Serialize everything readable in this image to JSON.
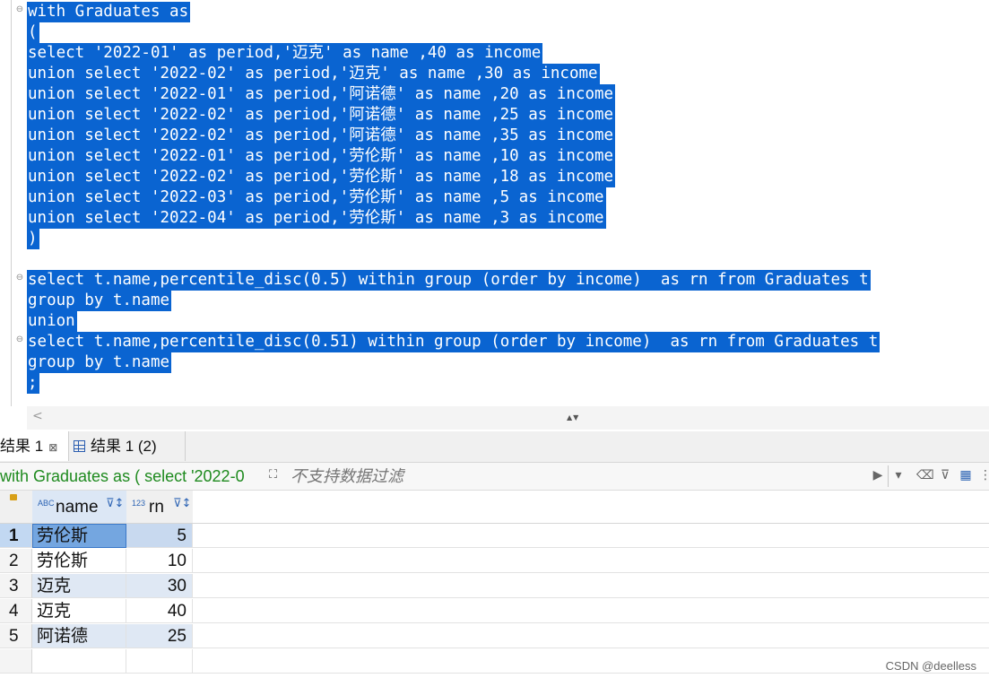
{
  "editor": {
    "lines": [
      "with Graduates as",
      "(",
      "select '2022-01' as period,'迈克' as name ,40 as income",
      "union select '2022-02' as period,'迈克' as name ,30 as income",
      "union select '2022-01' as period,'阿诺德' as name ,20 as income",
      "union select '2022-02' as period,'阿诺德' as name ,25 as income",
      "union select '2022-02' as period,'阿诺德' as name ,35 as income",
      "union select '2022-01' as period,'劳伦斯' as name ,10 as income",
      "union select '2022-02' as period,'劳伦斯' as name ,18 as income",
      "union select '2022-03' as period,'劳伦斯' as name ,5 as income",
      "union select '2022-04' as period,'劳伦斯' as name ,3 as income",
      ")",
      "",
      "select t.name,percentile_disc(0.5) within group (order by income)  as rn from Graduates t",
      "group by t.name",
      "union",
      "select t.name,percentile_disc(0.51) within group (order by income)  as rn from Graduates t",
      "group by t.name",
      ";"
    ]
  },
  "scroll": {
    "left_arrow": "<",
    "split_arrows": "▲▼"
  },
  "tabs": [
    {
      "label": "结果 1",
      "close": "⊠",
      "active": true
    },
    {
      "label": "结果 1 (2)",
      "active": false
    }
  ],
  "filterbar": {
    "sql_preview": "with Graduates as ( select '2022-0",
    "placeholder": "不支持数据过滤",
    "icons": [
      "expand-icon",
      "play-icon",
      "dropdown-icon",
      "eraser-icon",
      "filter-icon",
      "export-icon"
    ]
  },
  "grid": {
    "columns": [
      {
        "type": "ABC",
        "label": "name"
      },
      {
        "type": "123",
        "label": "rn"
      }
    ],
    "rows": [
      {
        "num": "1",
        "name": "劳伦斯",
        "rn": "5"
      },
      {
        "num": "2",
        "name": "劳伦斯",
        "rn": "10"
      },
      {
        "num": "3",
        "name": "迈克",
        "rn": "30"
      },
      {
        "num": "4",
        "name": "迈克",
        "rn": "40"
      },
      {
        "num": "5",
        "name": "阿诺德",
        "rn": "25"
      }
    ]
  },
  "credit": "CSDN @deelless",
  "colors": {
    "selection": "#0a64d1",
    "sql_preview": "#1e8a1e",
    "row_alt": "#dfe8f4"
  }
}
